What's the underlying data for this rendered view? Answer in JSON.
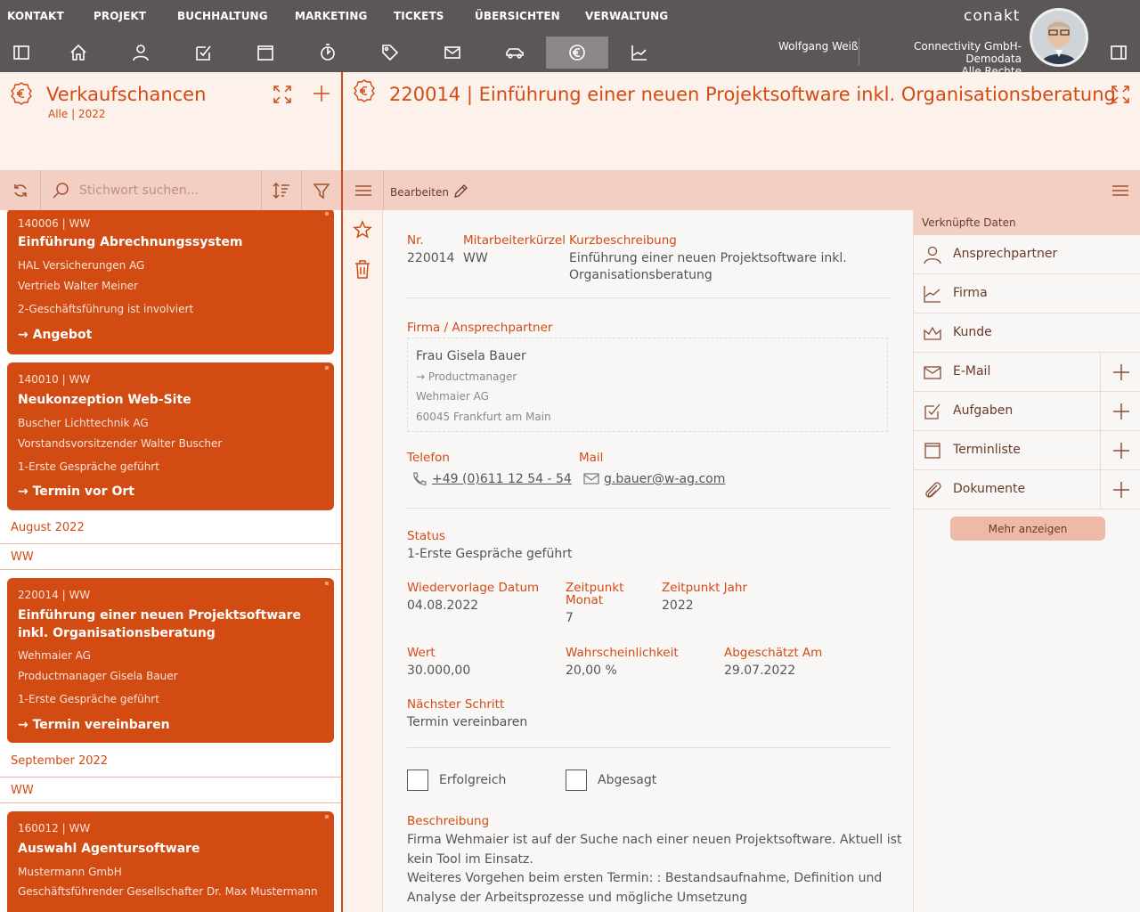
{
  "menu": [
    "KONTAKT",
    "PROJEKT",
    "BUCHHALTUNG",
    "MARKETING",
    "TICKETS",
    "ÜBERSICHTEN",
    "VERWALTUNG"
  ],
  "logo_text": "conakt",
  "toolbar_icons": [
    "sidebar-toggle-icon",
    "home-icon",
    "person-icon",
    "tasks-icon",
    "calendar-icon",
    "timer-icon",
    "tag-icon",
    "mail-icon",
    "car-icon",
    "euro-gear-icon",
    "chart-icon"
  ],
  "user": {
    "name": "Wolfgang Weiß",
    "company": "Connectivity GmbH-Demodata",
    "rights": "Alle Rechte"
  },
  "left_pane": {
    "title": "Verkaufschancen",
    "subtitle": "Alle | 2022",
    "search_placeholder": "Stichwort suchen..."
  },
  "cards": [
    {
      "num": "140006 | WW",
      "title": "Einführung Abrechnungssystem",
      "company": "HAL Versicherungen AG",
      "contact": "Vertrieb Walter Meiner",
      "status": "2-Geschäftsführung ist involviert",
      "next_step": "Angebot"
    },
    {
      "num": "140010 | WW",
      "title": "Neukonzeption Web-Site",
      "company": "Buscher Lichttechnik AG",
      "contact": "Vorstandsvorsitzender Walter Buscher",
      "status": "1-Erste Gespräche geführt",
      "next_step": "Termin vor Ort"
    },
    {
      "num": "220014 | WW",
      "title": "Einführung einer neuen Projektsoftware inkl. Organisationsberatung",
      "company": "Wehmaier AG",
      "contact": "Productmanager Gisela Bauer",
      "status": "1-Erste Gespräche geführt",
      "next_step": "Termin vereinbaren"
    },
    {
      "num": "160012 | WW",
      "title": "Auswahl Agentursoftware",
      "company": "Mustermann GmbH",
      "contact": "Geschäftsführender Gesellschafter Dr. Max Mustermann",
      "status": "",
      "next_step": ""
    }
  ],
  "groups": [
    {
      "month": "August 2022",
      "owner": "WW"
    },
    {
      "month": "September 2022",
      "owner": "WW"
    }
  ],
  "detail": {
    "title": "220014 | Einführung einer neuen Projektsoftware inkl. Organisationsberatung",
    "edit_label": "Bearbeiten",
    "labels": {
      "nr": "Nr.",
      "mitarbeiter": "Mitarbeiterkürzel",
      "kurz": "Kurzbeschreibung",
      "firma": "Firma / Ansprechpartner",
      "telefon": "Telefon",
      "mail": "Mail",
      "status": "Status",
      "wiedervorlage": "Wiedervorlage Datum",
      "zeitpunkt_monat_1": "Zeitpunkt",
      "zeitpunkt_monat_2": "Monat",
      "zeitpunkt_jahr": "Zeitpunkt Jahr",
      "wert": "Wert",
      "wahrscheinlichkeit": "Wahrscheinlichkeit",
      "abgeschaetzt": "Abgeschätzt Am",
      "naechster": "Nächster Schritt",
      "beschreibung": "Beschreibung"
    },
    "nr": "220014",
    "mitarbeiter": "WW",
    "kurz_1": "Einführung einer neuen Projektsoftware inkl.",
    "kurz_2": "Organisationsberatung",
    "contact_salutation": "Frau ",
    "contact_name": "Gisela Bauer",
    "contact_role": "→ Productmanager",
    "contact_company": "Wehmaier AG",
    "contact_city": "60045 Frankfurt am Main",
    "telefon": "+49 (0)611 12 54 - 54",
    "mail": "g.bauer@w-ag.com",
    "status": "1-Erste Gespräche geführt",
    "wiedervorlage": "04.08.2022",
    "zeitpunkt_monat": "7",
    "zeitpunkt_jahr": "2022",
    "wert": "30.000,00",
    "wahrscheinlichkeit": "20,00 %",
    "abgeschaetzt": "29.07.2022",
    "naechster": "Termin vereinbaren",
    "checkbox_1": "Erfolgreich",
    "checkbox_2": "Abgesagt",
    "beschreibung_1": "Firma Wehmaier ist auf der Suche nach einer neuen Projektsoftware. Aktuell ist",
    "beschreibung_2": "kein Tool im Einsatz.",
    "beschreibung_3": "Weiteres Vorgehen beim ersten Termin: : Bestandsaufnahme, Definition und",
    "beschreibung_4": "Analyse der Arbeitsprozesse und mögliche Umsetzung"
  },
  "linked": {
    "title": "Verknüpfte Daten",
    "items": [
      {
        "label": "Ansprechpartner",
        "icon": "person-icon",
        "plus": false
      },
      {
        "label": "Firma",
        "icon": "chart-icon",
        "plus": false
      },
      {
        "label": "Kunde",
        "icon": "crown-icon",
        "plus": false
      },
      {
        "label": "E-Mail",
        "icon": "mail-icon",
        "plus": true
      },
      {
        "label": "Aufgaben",
        "icon": "tasks-icon",
        "plus": true
      },
      {
        "label": "Terminliste",
        "icon": "calendar-icon",
        "plus": true
      },
      {
        "label": "Dokumente",
        "icon": "paperclip-icon",
        "plus": true
      }
    ],
    "more": "Mehr anzeigen"
  },
  "colors": {
    "accent": "#d14b13",
    "bar": "#5a5756",
    "tint": "#f3cfc3",
    "light": "#fdf1ec"
  }
}
